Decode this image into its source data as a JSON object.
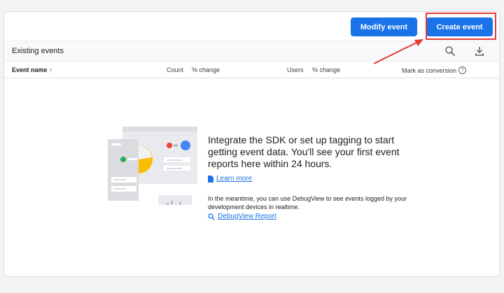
{
  "toolbar": {
    "modify_label": "Modify event",
    "create_label": "Create event"
  },
  "table": {
    "title": "Existing events",
    "columns": {
      "event_name": "Event name",
      "count": "Count",
      "count_change": "% change",
      "users": "Users",
      "users_change": "% change",
      "mark_conversion": "Mark as conversion"
    },
    "sort_indicator": "↑",
    "help_glyph": "?"
  },
  "empty_state": {
    "headline": "Integrate the SDK or set up tagging to start getting event data. You'll see your first event reports here within 24 hours.",
    "learn_more": "Learn more",
    "meantime": "In the meantime, you can use DebugView to see events logged by your development devices in realtime.",
    "debugview_link": "DebugView Report"
  },
  "icons": {
    "search": "search-icon",
    "download": "download-icon",
    "doc": "document-icon",
    "debug": "debug-search-icon"
  },
  "colors": {
    "primary": "#1a73e8",
    "annotation": "#e53935"
  }
}
